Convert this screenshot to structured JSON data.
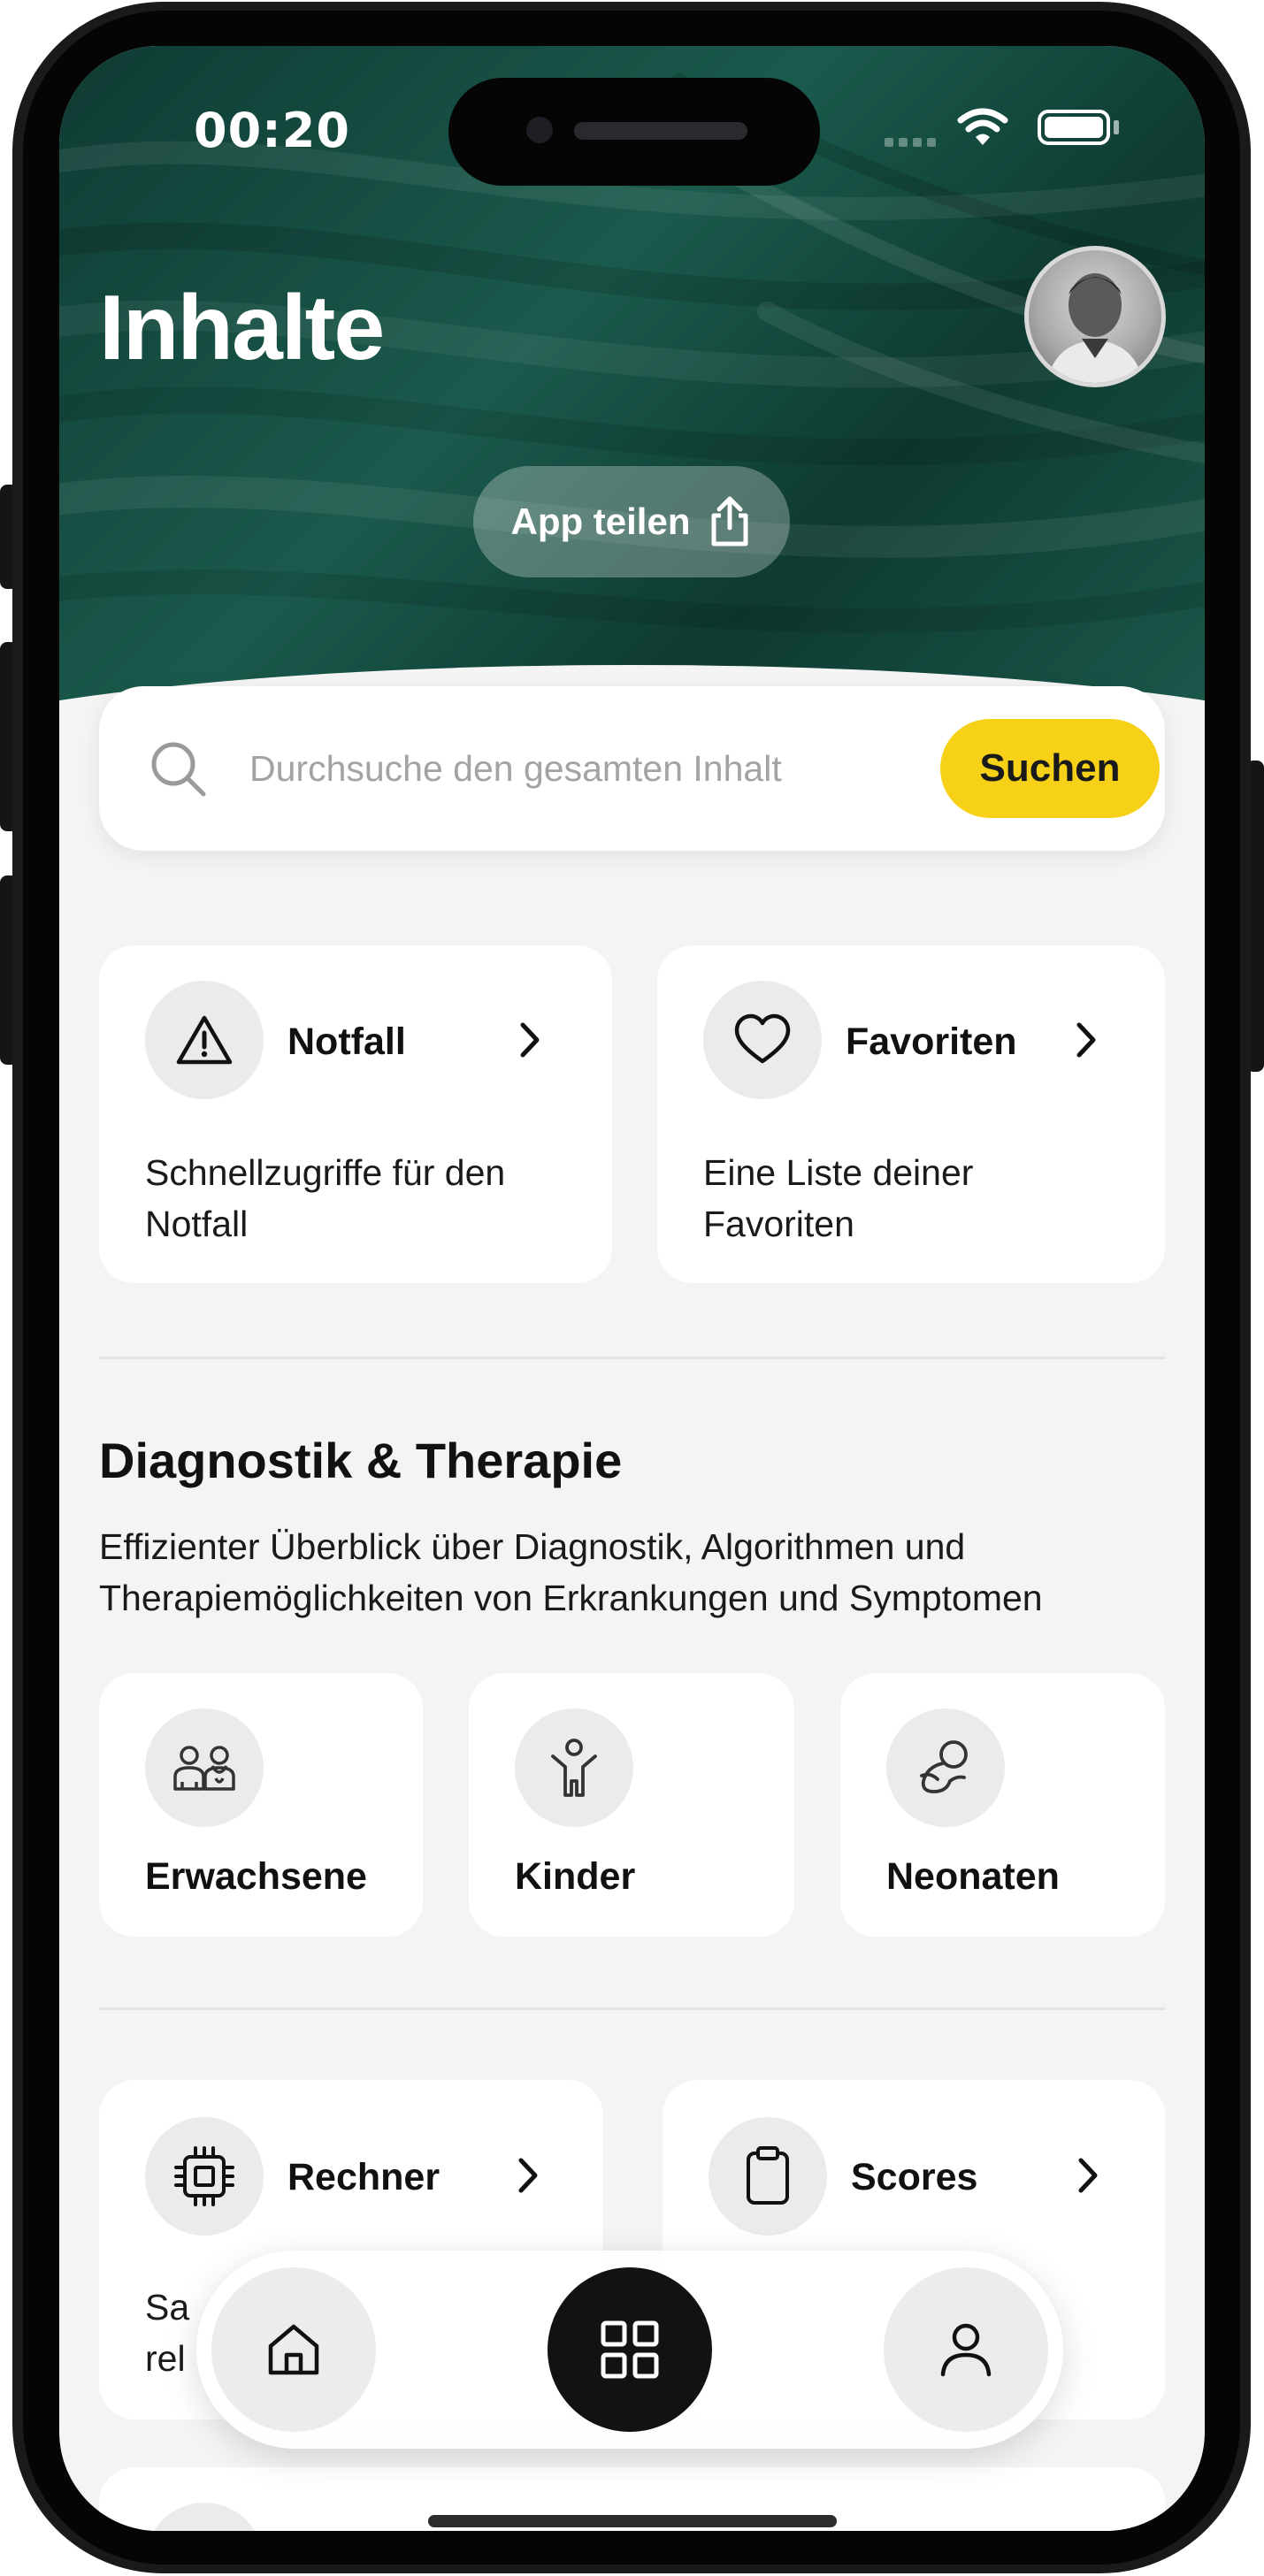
{
  "status_bar": {
    "time": "00:20"
  },
  "header": {
    "title": "Inhalte",
    "share_label": "App teilen"
  },
  "search": {
    "placeholder": "Durchsuche den gesamten Inhalt",
    "button_label": "Suchen"
  },
  "quick_access": [
    {
      "title": "Notfall",
      "description": "Schnellzugriffe für den Notfall",
      "icon": "warning-triangle-icon"
    },
    {
      "title": "Favoriten",
      "description": "Eine Liste deiner Favoriten",
      "icon": "heart-icon"
    }
  ],
  "diagnostics": {
    "title": "Diagnostik & Therapie",
    "description": "Effizienter Überblick über Diagnostik, Algorithmen und Therapiemöglichkeiten von Erkrankungen und Symptomen",
    "categories": [
      {
        "label": "Erwachsene",
        "icon": "adults-icon"
      },
      {
        "label": "Kinder",
        "icon": "child-icon"
      },
      {
        "label": "Neonaten",
        "icon": "neonate-icon"
      }
    ]
  },
  "tools": [
    {
      "title": "Rechner",
      "description_start": "Sa",
      "description_start_line2": "rel",
      "icon": "chip-icon"
    },
    {
      "title": "Scores",
      "icon": "clipboard-icon"
    }
  ],
  "bottom_nav": {
    "items": [
      {
        "name": "home",
        "icon": "home-icon",
        "active": false
      },
      {
        "name": "contents",
        "icon": "grid-icon",
        "active": true
      },
      {
        "name": "profile",
        "icon": "user-icon",
        "active": false
      }
    ]
  },
  "colors": {
    "header_green": "#1a5a4c",
    "accent_yellow": "#f6d117",
    "background": "#f4f4f4",
    "nav_active": "#121212"
  }
}
